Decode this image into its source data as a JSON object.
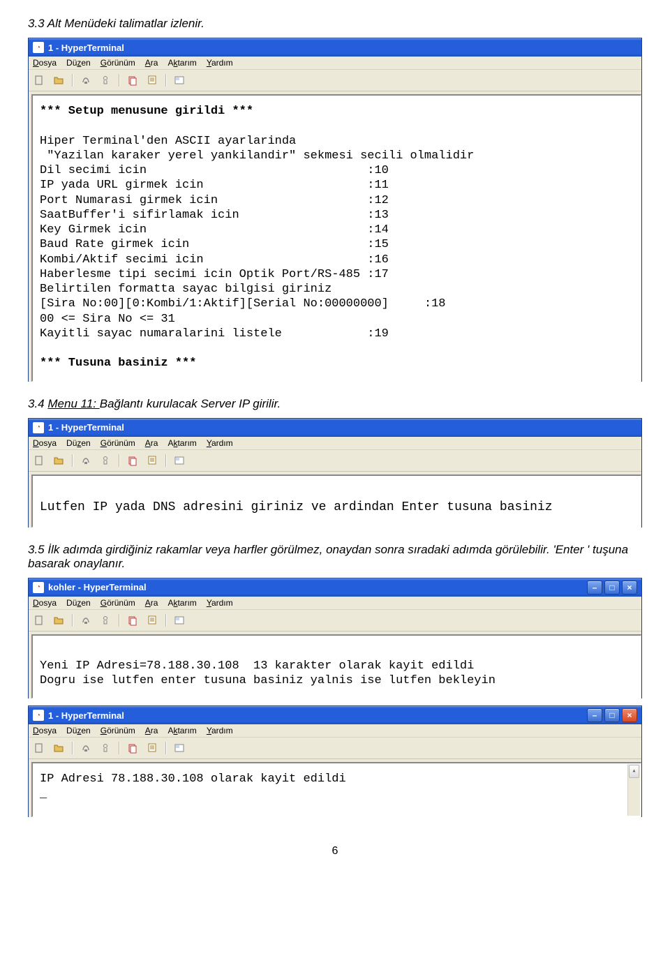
{
  "doc": {
    "p33": "3.3 Alt Menüdeki talimatlar izlenir.",
    "p34a": "3.4",
    "p34b": "Menu 11:",
    "p34c": "Bağlantı kurulacak Server IP girilir.",
    "p35": "3.5 İlk adımda girdiğiniz rakamlar veya harfler görülmez, onaydan sonra sıradaki adımda görülebilir. 'Enter ' tuşuna basarak onaylanır.",
    "page_num": "6"
  },
  "menus": {
    "dosya": "Dosya",
    "duzen": "Düzen",
    "gorunum": "Görünüm",
    "ara": "Ara",
    "aktarim": "Aktarım",
    "yardim": "Yardım"
  },
  "window1": {
    "title": "1 - HyperTerminal",
    "line_bold1": "*** Setup menusune girildi ***",
    "body": "Hiper Terminal'den ASCII ayarlarinda\n \"Yazilan karaker yerel yankilandir\" sekmesi secili olmalidir\nDil secimi icin                               :10\nIP yada URL girmek icin                       :11\nPort Numarasi girmek icin                     :12\nSaatBuffer'i sifirlamak icin                  :13\nKey Girmek icin                               :14\nBaud Rate girmek icin                         :15\nKombi/Aktif secimi icin                       :16\nHaberlesme tipi secimi icin Optik Port/RS-485 :17\nBelirtilen formatta sayac bilgisi giriniz\n[Sira No:00][0:Kombi/1:Aktif][Serial No:00000000]     :18\n00 <= Sira No <= 31\nKayitli sayac numaralarini listele            :19",
    "line_bold2": "*** Tusuna basiniz ***"
  },
  "window2": {
    "title": "1 - HyperTerminal",
    "body": "Lutfen IP yada DNS adresini giriniz ve ardindan Enter tusuna basiniz"
  },
  "window3": {
    "title": "kohler - HyperTerminal",
    "body": "Yeni IP Adresi=78.188.30.108  13 karakter olarak kayit edildi\nDogru ise lutfen enter tusuna basiniz yalnis ise lutfen bekleyin"
  },
  "window4": {
    "title": "1 - HyperTerminal",
    "body": "IP Adresi 78.188.30.108 olarak kayit edildi\n_"
  }
}
